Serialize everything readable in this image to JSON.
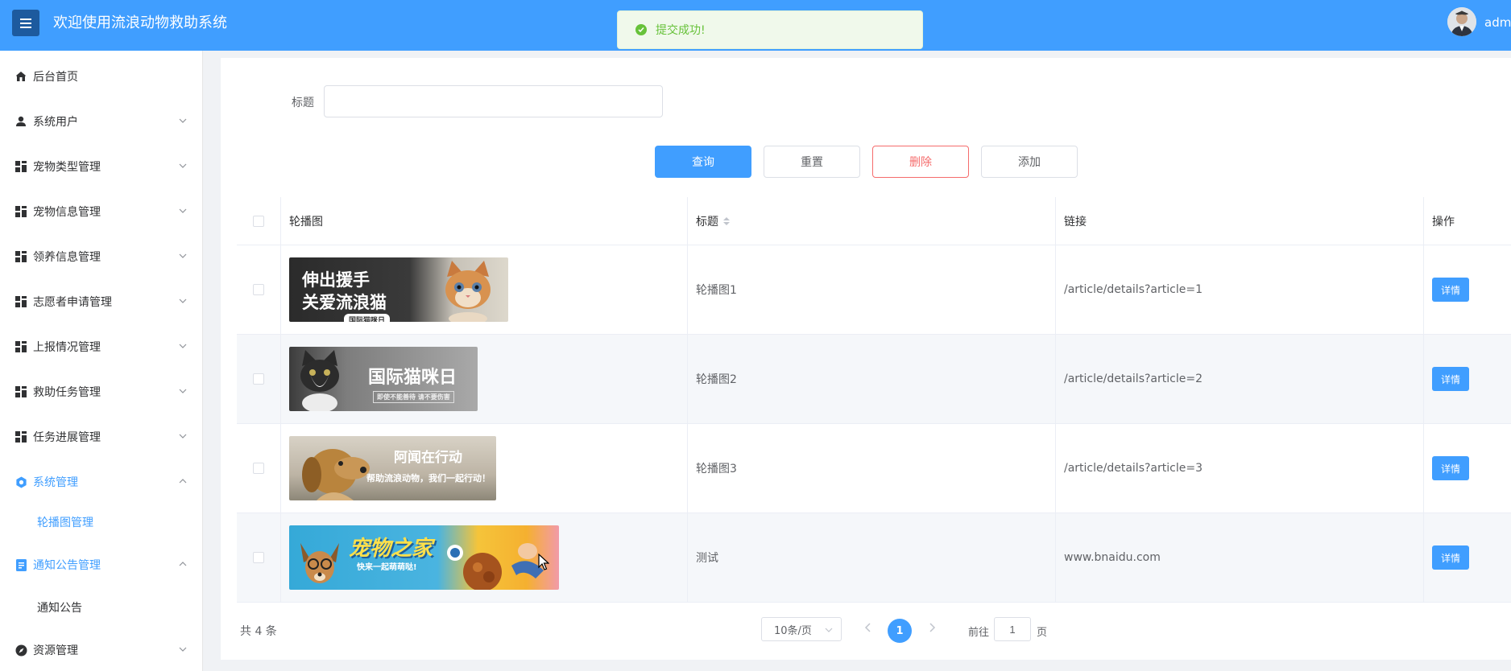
{
  "header": {
    "title": "欢迎使用流浪动物救助系统",
    "admin": "admin",
    "bg_color": "#409eff"
  },
  "toast": {
    "message": "提交成功!",
    "type": "success"
  },
  "sidebar": {
    "items": [
      {
        "label": "后台首页",
        "icon": "home-icon"
      },
      {
        "label": "系统用户",
        "icon": "user-icon"
      },
      {
        "label": "宠物类型管理",
        "icon": "grid-icon"
      },
      {
        "label": "宠物信息管理",
        "icon": "grid-icon"
      },
      {
        "label": "领养信息管理",
        "icon": "grid-icon"
      },
      {
        "label": "志愿者申请管理",
        "icon": "grid-icon"
      },
      {
        "label": "上报情况管理",
        "icon": "grid-icon"
      },
      {
        "label": "救助任务管理",
        "icon": "grid-icon"
      },
      {
        "label": "任务进展管理",
        "icon": "grid-icon"
      },
      {
        "label": "系统管理",
        "icon": "gear-icon",
        "active": true,
        "children": [
          {
            "label": "轮播图管理",
            "active": true
          }
        ]
      },
      {
        "label": "通知公告管理",
        "icon": "document-icon",
        "children": [
          {
            "label": "通知公告"
          }
        ]
      },
      {
        "label": "资源管理",
        "icon": "compass-icon"
      }
    ]
  },
  "search": {
    "label": "标题",
    "value": "",
    "placeholder": ""
  },
  "buttons": {
    "query": "查询",
    "reset": "重置",
    "delete": "删除",
    "add": "添加"
  },
  "table": {
    "columns": [
      "轮播图",
      "标题",
      "链接",
      "操作"
    ],
    "rows": [
      {
        "banner": {
          "lines": [
            "伸出援手",
            "关爱流浪猫"
          ],
          "sub": "国际猫咪日"
        },
        "title": "轮播图1",
        "link": "/article/details?article=1",
        "action": "详情"
      },
      {
        "banner": {
          "lines": [
            "国际猫咪日"
          ],
          "sub": "即使不能善待 请不要伤害"
        },
        "title": "轮播图2",
        "link": "/article/details?article=2",
        "action": "详情"
      },
      {
        "banner": {
          "lines": [
            "阿闻在行动"
          ],
          "sub": "帮助流浪动物，我们一起行动！"
        },
        "title": "轮播图3",
        "link": "/article/details?article=3",
        "action": "详情"
      },
      {
        "banner": {
          "lines": [
            "宠物之家"
          ],
          "sub": "快来一起萌萌哒!"
        },
        "title": "测试",
        "link": "www.bnaidu.com",
        "action": "详情"
      }
    ]
  },
  "pagination": {
    "total": "共 4 条",
    "page_size": "10条/页",
    "current": "1",
    "goto_label": "前往",
    "goto_value": "1",
    "goto_suffix": "页"
  }
}
